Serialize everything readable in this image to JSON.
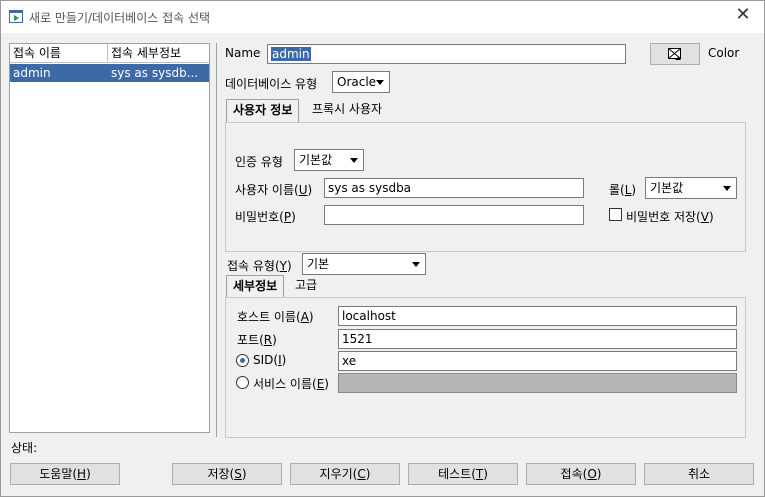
{
  "window": {
    "title": "새로 만들기/데이터베이스 접속 선택"
  },
  "list": {
    "headers": [
      "접속 이름",
      "접속 세부정보"
    ],
    "rows": [
      {
        "name": "admin",
        "details": "sys as sysdb..."
      }
    ]
  },
  "form": {
    "name_label": "Name",
    "name_value": "admin",
    "color_label": "Color",
    "db_type_label": "데이터베이스 유형",
    "db_type_value": "Oracle",
    "tabs_top": [
      "사용자 정보",
      "프록시 사용자"
    ],
    "auth_type_label": "인증 유형",
    "auth_type_value": "기본값",
    "username_label": "사용자 이름(",
    "username_mnemonic": "U",
    "username_value": "sys as sysdba",
    "role_label": "롤(",
    "role_mnemonic": "L",
    "role_value": "기본값",
    "password_label": "비밀번호(",
    "password_mnemonic": "P",
    "save_password_label": "비밀번호 저장(",
    "save_password_mnemonic": "V",
    "conn_type_label": "접속 유형(",
    "conn_type_mnemonic": "Y",
    "conn_type_value": "기본",
    "tabs_bottom": [
      "세부정보",
      "고급"
    ],
    "host_label": "호스트 이름(",
    "host_mnemonic": "A",
    "host_value": "localhost",
    "port_label": "포트(",
    "port_mnemonic": "R",
    "port_value": "1521",
    "sid_label": "SID(",
    "sid_mnemonic": "I",
    "sid_value": "xe",
    "service_label": "서비스 이름(",
    "service_mnemonic": "E"
  },
  "status_label": "상태:",
  "buttons": {
    "help": {
      "label": "도움말(",
      "mnemonic": "H"
    },
    "save": {
      "label": "저장(",
      "mnemonic": "S"
    },
    "clear": {
      "label": "지우기(",
      "mnemonic": "C"
    },
    "test": {
      "label": "테스트(",
      "mnemonic": "T"
    },
    "connect": {
      "label": "접속(",
      "mnemonic": "O"
    },
    "cancel": {
      "label": "취소"
    }
  },
  "colors": {
    "selection": "#3d6aa6",
    "window_bg": "#f0f0f0"
  }
}
